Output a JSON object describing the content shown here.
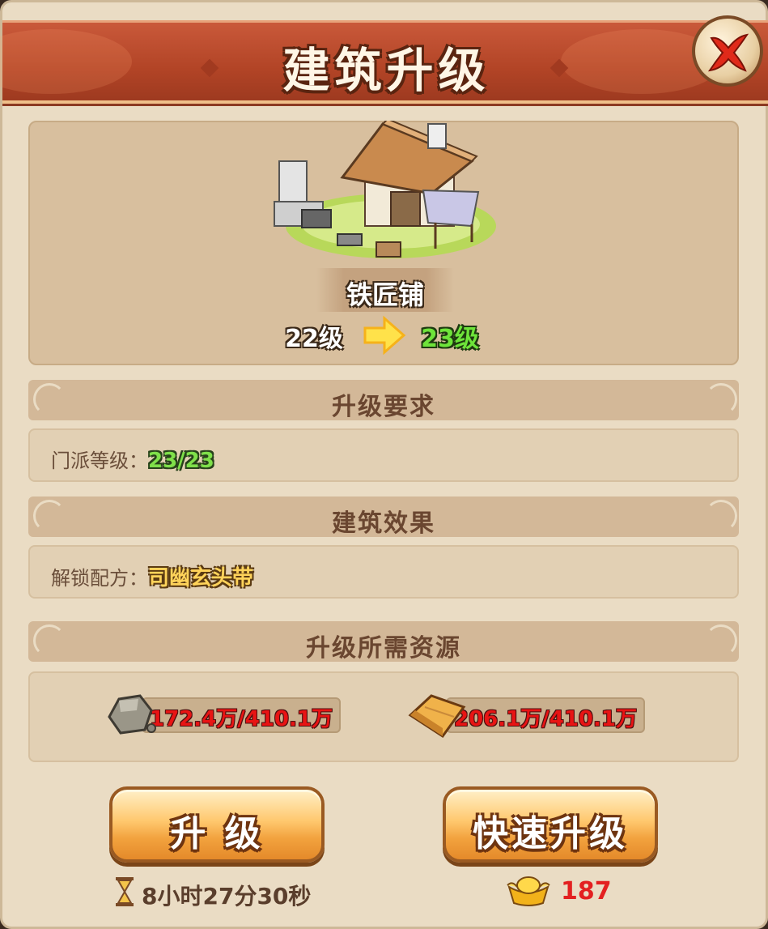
{
  "header": {
    "title": "建筑升级"
  },
  "building": {
    "name": "铁匠铺",
    "level_from": "22级",
    "level_to": "23级"
  },
  "requirements": {
    "header": "升级要求",
    "label": "门派等级：",
    "value": "23/23"
  },
  "effects": {
    "header": "建筑效果",
    "label": "解锁配方：",
    "value": "司幽玄头带"
  },
  "resources": {
    "header": "升级所需资源",
    "stone": {
      "icon": "stone-icon",
      "value": "172.4万/410.1万"
    },
    "wood": {
      "icon": "wood-icon",
      "value": "206.1万/410.1万"
    }
  },
  "actions": {
    "upgrade_label": "升 级",
    "upgrade_time": "8小时27分30秒",
    "quick_upgrade_label": "快速升级",
    "quick_upgrade_cost": "187"
  },
  "colors": {
    "title_bar": "#b24426",
    "panel": "#eadcc4",
    "green_value": "#7fe04a",
    "gold_value": "#ffd35a",
    "red_value": "#e81414"
  }
}
